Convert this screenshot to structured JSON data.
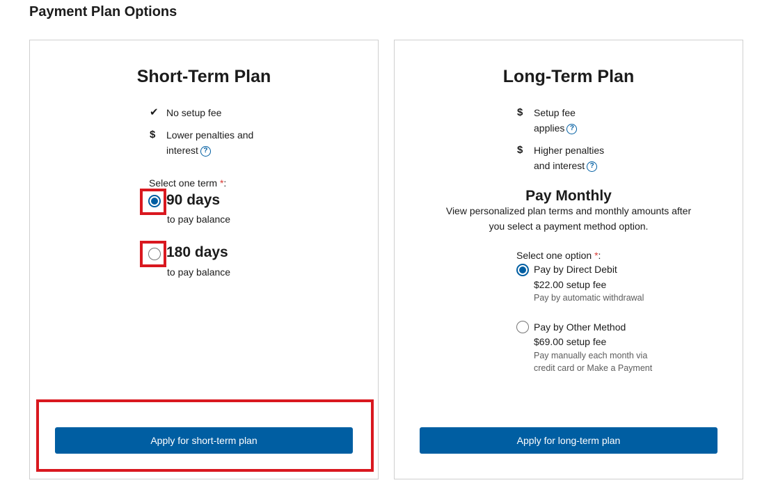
{
  "page": {
    "title": "Payment Plan Options"
  },
  "short_term": {
    "title": "Short-Term Plan",
    "features": [
      {
        "icon": "check-icon",
        "text": "No setup fee"
      },
      {
        "icon": "dollar-icon",
        "line1": "Lower penalties and",
        "line2": "interest"
      }
    ],
    "select_label": "Select one term",
    "required_mark": "*",
    "colon": ":",
    "options": [
      {
        "days": "90 days",
        "sub": "to pay balance",
        "selected": true
      },
      {
        "days": "180 days",
        "sub": "to pay balance",
        "selected": false
      }
    ],
    "button": "Apply for short-term plan"
  },
  "long_term": {
    "title": "Long-Term Plan",
    "features": [
      {
        "icon": "dollar-icon",
        "line1": "Setup fee",
        "line2": "applies"
      },
      {
        "icon": "dollar-icon",
        "line1": "Higher penalties",
        "line2": "and interest"
      }
    ],
    "pay_monthly": {
      "title": "Pay Monthly",
      "desc_line1": "View personalized plan terms and monthly amounts after",
      "desc_line2": "you select a payment method option."
    },
    "select_label": "Select one option",
    "required_mark": "*",
    "colon": ":",
    "options": [
      {
        "title": "Pay by Direct Debit",
        "fee": "$22.00 setup fee",
        "note_line1": "Pay by automatic withdrawal",
        "note_line2": "",
        "selected": true
      },
      {
        "title": "Pay by Other Method",
        "fee": "$69.00 setup fee",
        "note_line1": "Pay manually each month via",
        "note_line2": "credit card or Make a Payment",
        "selected": false
      }
    ],
    "button": "Apply for long-term plan"
  },
  "icons": {
    "help": "?",
    "check": "✔",
    "dollar": "$"
  },
  "colors": {
    "primary": "#005ea2",
    "highlight": "#d9181f",
    "required": "#d83933"
  }
}
